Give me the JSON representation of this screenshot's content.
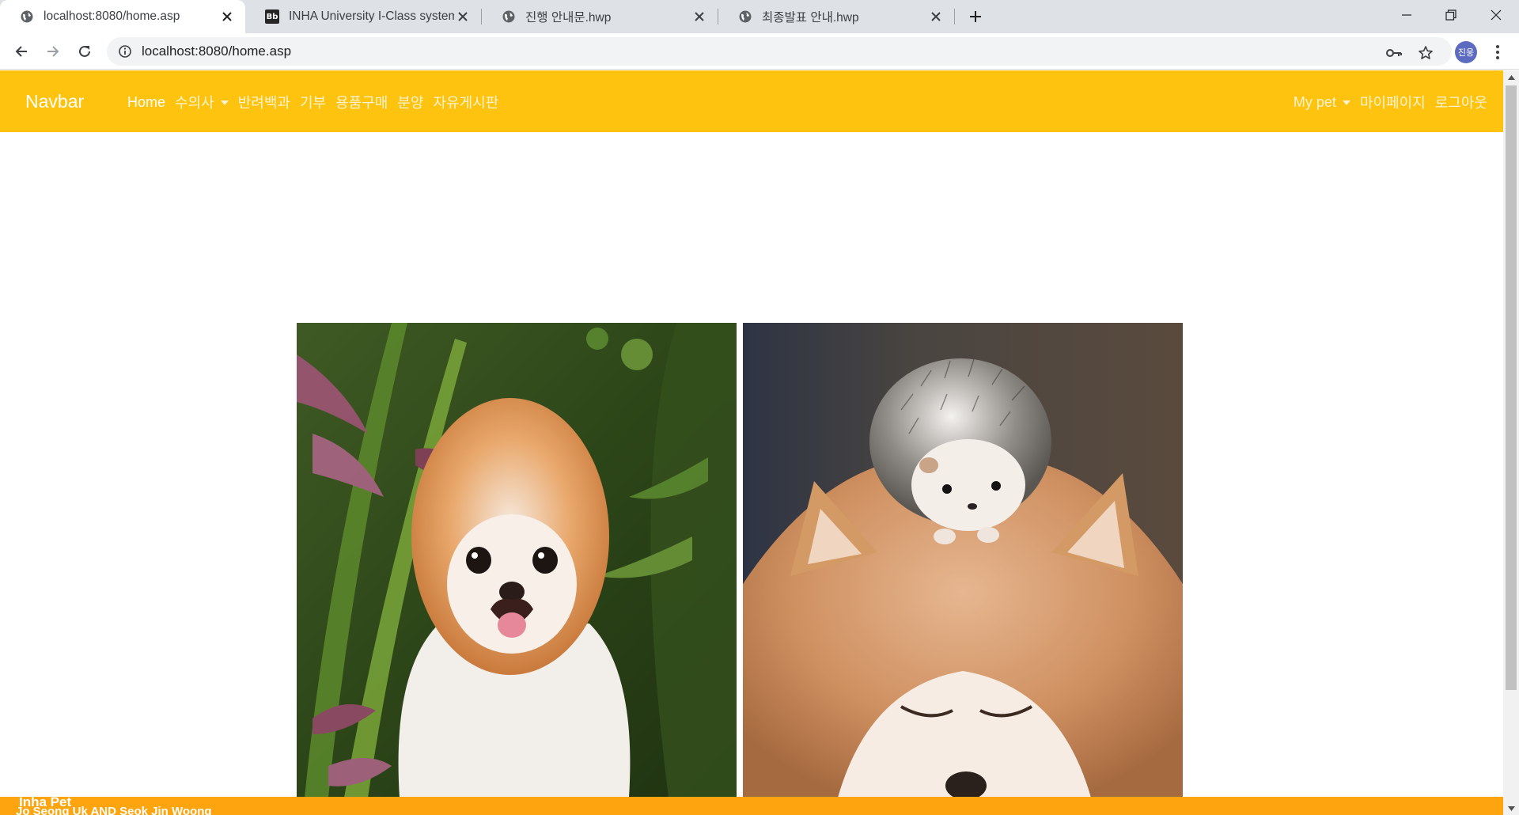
{
  "browser": {
    "tabs": [
      {
        "title": "localhost:8080/home.asp",
        "favicon": "globe-icon",
        "active": true
      },
      {
        "title": "INHA University I-Class system",
        "favicon": "blackboard-icon",
        "active": false
      },
      {
        "title": "진행 안내문.hwp",
        "favicon": "globe-icon",
        "active": false
      },
      {
        "title": "최종발표 안내.hwp",
        "favicon": "globe-icon",
        "active": false
      }
    ],
    "address": {
      "url": "localhost:8080/home.asp"
    },
    "profile_initials": "진웅",
    "favicon_text": "Bb"
  },
  "navbar": {
    "brand": "Navbar",
    "items": [
      {
        "label": "Home",
        "active": true
      },
      {
        "label": "수의사",
        "dropdown": true
      },
      {
        "label": "반려백과"
      },
      {
        "label": "기부"
      },
      {
        "label": "용품구매"
      },
      {
        "label": "분양"
      },
      {
        "label": "자유게시판"
      }
    ],
    "right_items": [
      {
        "label": "My pet",
        "dropdown": true
      },
      {
        "label": "마이페이지"
      },
      {
        "label": "로그아웃"
      }
    ]
  },
  "gallery": {
    "images": [
      {
        "subject": "pomeranian-dog-photo"
      },
      {
        "subject": "hedgehog-on-shiba-photo"
      }
    ]
  },
  "footer": {
    "title": "Inha Pet",
    "credits": "Jo Seong Uk AND Seok Jin Woong"
  },
  "colors": {
    "navbar": "#fec30f",
    "footer": "#fea40f",
    "tabstrip": "#dee1e6"
  }
}
